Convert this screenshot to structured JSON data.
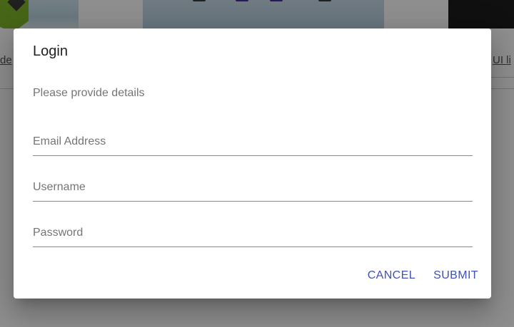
{
  "background": {
    "left_link_text": "de",
    "right_link_text": "UI li"
  },
  "dialog": {
    "title": "Login",
    "description": "Please provide details",
    "fields": {
      "email": {
        "label": "Email Address",
        "value": ""
      },
      "username": {
        "label": "Username",
        "value": ""
      },
      "password": {
        "label": "Password",
        "value": ""
      }
    },
    "actions": {
      "cancel_label": "CANCEL",
      "submit_label": "SUBMIT"
    }
  },
  "colors": {
    "primary": "#3f51b5",
    "label_gray": "#757575",
    "scrim": "rgba(0,0,0,0.44)"
  }
}
